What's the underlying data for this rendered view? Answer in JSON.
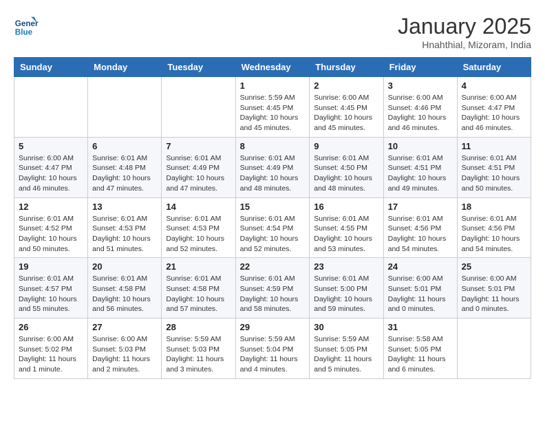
{
  "header": {
    "logo_line1": "General",
    "logo_line2": "Blue",
    "month": "January 2025",
    "location": "Hnahthial, Mizoram, India"
  },
  "weekdays": [
    "Sunday",
    "Monday",
    "Tuesday",
    "Wednesday",
    "Thursday",
    "Friday",
    "Saturday"
  ],
  "weeks": [
    [
      {
        "day": "",
        "info": ""
      },
      {
        "day": "",
        "info": ""
      },
      {
        "day": "",
        "info": ""
      },
      {
        "day": "1",
        "info": "Sunrise: 5:59 AM\nSunset: 4:45 PM\nDaylight: 10 hours\nand 45 minutes."
      },
      {
        "day": "2",
        "info": "Sunrise: 6:00 AM\nSunset: 4:45 PM\nDaylight: 10 hours\nand 45 minutes."
      },
      {
        "day": "3",
        "info": "Sunrise: 6:00 AM\nSunset: 4:46 PM\nDaylight: 10 hours\nand 46 minutes."
      },
      {
        "day": "4",
        "info": "Sunrise: 6:00 AM\nSunset: 4:47 PM\nDaylight: 10 hours\nand 46 minutes."
      }
    ],
    [
      {
        "day": "5",
        "info": "Sunrise: 6:00 AM\nSunset: 4:47 PM\nDaylight: 10 hours\nand 46 minutes."
      },
      {
        "day": "6",
        "info": "Sunrise: 6:01 AM\nSunset: 4:48 PM\nDaylight: 10 hours\nand 47 minutes."
      },
      {
        "day": "7",
        "info": "Sunrise: 6:01 AM\nSunset: 4:49 PM\nDaylight: 10 hours\nand 47 minutes."
      },
      {
        "day": "8",
        "info": "Sunrise: 6:01 AM\nSunset: 4:49 PM\nDaylight: 10 hours\nand 48 minutes."
      },
      {
        "day": "9",
        "info": "Sunrise: 6:01 AM\nSunset: 4:50 PM\nDaylight: 10 hours\nand 48 minutes."
      },
      {
        "day": "10",
        "info": "Sunrise: 6:01 AM\nSunset: 4:51 PM\nDaylight: 10 hours\nand 49 minutes."
      },
      {
        "day": "11",
        "info": "Sunrise: 6:01 AM\nSunset: 4:51 PM\nDaylight: 10 hours\nand 50 minutes."
      }
    ],
    [
      {
        "day": "12",
        "info": "Sunrise: 6:01 AM\nSunset: 4:52 PM\nDaylight: 10 hours\nand 50 minutes."
      },
      {
        "day": "13",
        "info": "Sunrise: 6:01 AM\nSunset: 4:53 PM\nDaylight: 10 hours\nand 51 minutes."
      },
      {
        "day": "14",
        "info": "Sunrise: 6:01 AM\nSunset: 4:53 PM\nDaylight: 10 hours\nand 52 minutes."
      },
      {
        "day": "15",
        "info": "Sunrise: 6:01 AM\nSunset: 4:54 PM\nDaylight: 10 hours\nand 52 minutes."
      },
      {
        "day": "16",
        "info": "Sunrise: 6:01 AM\nSunset: 4:55 PM\nDaylight: 10 hours\nand 53 minutes."
      },
      {
        "day": "17",
        "info": "Sunrise: 6:01 AM\nSunset: 4:56 PM\nDaylight: 10 hours\nand 54 minutes."
      },
      {
        "day": "18",
        "info": "Sunrise: 6:01 AM\nSunset: 4:56 PM\nDaylight: 10 hours\nand 54 minutes."
      }
    ],
    [
      {
        "day": "19",
        "info": "Sunrise: 6:01 AM\nSunset: 4:57 PM\nDaylight: 10 hours\nand 55 minutes."
      },
      {
        "day": "20",
        "info": "Sunrise: 6:01 AM\nSunset: 4:58 PM\nDaylight: 10 hours\nand 56 minutes."
      },
      {
        "day": "21",
        "info": "Sunrise: 6:01 AM\nSunset: 4:58 PM\nDaylight: 10 hours\nand 57 minutes."
      },
      {
        "day": "22",
        "info": "Sunrise: 6:01 AM\nSunset: 4:59 PM\nDaylight: 10 hours\nand 58 minutes."
      },
      {
        "day": "23",
        "info": "Sunrise: 6:01 AM\nSunset: 5:00 PM\nDaylight: 10 hours\nand 59 minutes."
      },
      {
        "day": "24",
        "info": "Sunrise: 6:00 AM\nSunset: 5:01 PM\nDaylight: 11 hours\nand 0 minutes."
      },
      {
        "day": "25",
        "info": "Sunrise: 6:00 AM\nSunset: 5:01 PM\nDaylight: 11 hours\nand 0 minutes."
      }
    ],
    [
      {
        "day": "26",
        "info": "Sunrise: 6:00 AM\nSunset: 5:02 PM\nDaylight: 11 hours\nand 1 minute."
      },
      {
        "day": "27",
        "info": "Sunrise: 6:00 AM\nSunset: 5:03 PM\nDaylight: 11 hours\nand 2 minutes."
      },
      {
        "day": "28",
        "info": "Sunrise: 5:59 AM\nSunset: 5:03 PM\nDaylight: 11 hours\nand 3 minutes."
      },
      {
        "day": "29",
        "info": "Sunrise: 5:59 AM\nSunset: 5:04 PM\nDaylight: 11 hours\nand 4 minutes."
      },
      {
        "day": "30",
        "info": "Sunrise: 5:59 AM\nSunset: 5:05 PM\nDaylight: 11 hours\nand 5 minutes."
      },
      {
        "day": "31",
        "info": "Sunrise: 5:58 AM\nSunset: 5:05 PM\nDaylight: 11 hours\nand 6 minutes."
      },
      {
        "day": "",
        "info": ""
      }
    ]
  ]
}
